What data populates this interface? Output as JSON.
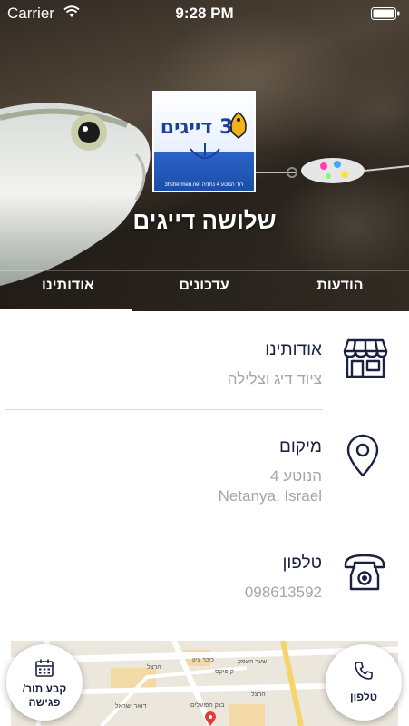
{
  "status_bar": {
    "carrier": "Carrier",
    "time": "9:28 PM"
  },
  "header": {
    "title": "שלושה דייגים",
    "logo": {
      "text": "3 דייגים",
      "subtext": "רח' הנוטע 4 נתניה   3fishermen.net"
    }
  },
  "tabs": [
    {
      "label": "אודותינו",
      "active": true
    },
    {
      "label": "עדכונים",
      "active": false
    },
    {
      "label": "הודעות",
      "active": false
    }
  ],
  "about": {
    "title": "אודותינו",
    "description": "ציוד דיג וצלילה",
    "icon": "store-icon"
  },
  "location": {
    "title": "מיקום",
    "line1": "הנוטע 4",
    "line2": "Netanya, Israel",
    "icon": "map-pin-icon"
  },
  "phone": {
    "title": "טלפון",
    "number": "098613592",
    "icon": "telephone-icon"
  },
  "map": {
    "labels": [
      "שער העמק",
      "הרצל",
      "כיכר ציון",
      "קופיקס",
      "דואר ישראל",
      "בנק הפועלים",
      "הרצל"
    ]
  },
  "actions": {
    "appointment_label": "קבע תור/ פגישה",
    "phone_label": "טלפון"
  },
  "colors": {
    "primary": "#1a2142",
    "muted": "#a7a7a7"
  }
}
